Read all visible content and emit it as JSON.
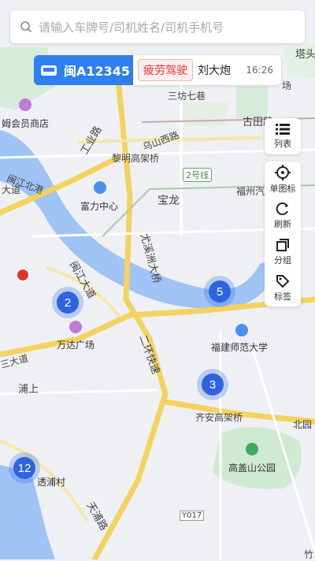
{
  "search": {
    "placeholder": "请输入车牌号/司机姓名/司机手机号"
  },
  "vehicle": {
    "plate": "闽A12345",
    "status_tag": "疲劳驾驶",
    "driver": "刘大炮",
    "time": "16:26"
  },
  "toolbar": {
    "list_label": "列表",
    "items": [
      {
        "label": "单图标"
      },
      {
        "label": "刷新"
      },
      {
        "label": "分组"
      },
      {
        "label": "标签"
      }
    ]
  },
  "clusters": [
    {
      "count": "2"
    },
    {
      "count": "5"
    },
    {
      "count": "3"
    },
    {
      "count": "12"
    }
  ],
  "places": [
    "三坊七巷",
    "乌山西路",
    "古田路",
    "工业路",
    "黎明高架桥",
    "2号线",
    "福州汽",
    "富力中心",
    "宝龙",
    "尤溪洲大桥",
    "闽江大道",
    "万达广场",
    "二环快速",
    "福建师范大学",
    "浦上",
    "齐安高架桥",
    "北园",
    "高盖山公园",
    "透浦村",
    "天浦路",
    "Y017",
    "塔头",
    "竹",
    "闽江北港",
    "姆会员商店",
    "大道",
    "场",
    "三大道"
  ],
  "colors": {
    "accent": "#2e7ff0",
    "alert": "#e0352b",
    "cluster": "#2f63e0",
    "water": "#9fc3f5"
  }
}
